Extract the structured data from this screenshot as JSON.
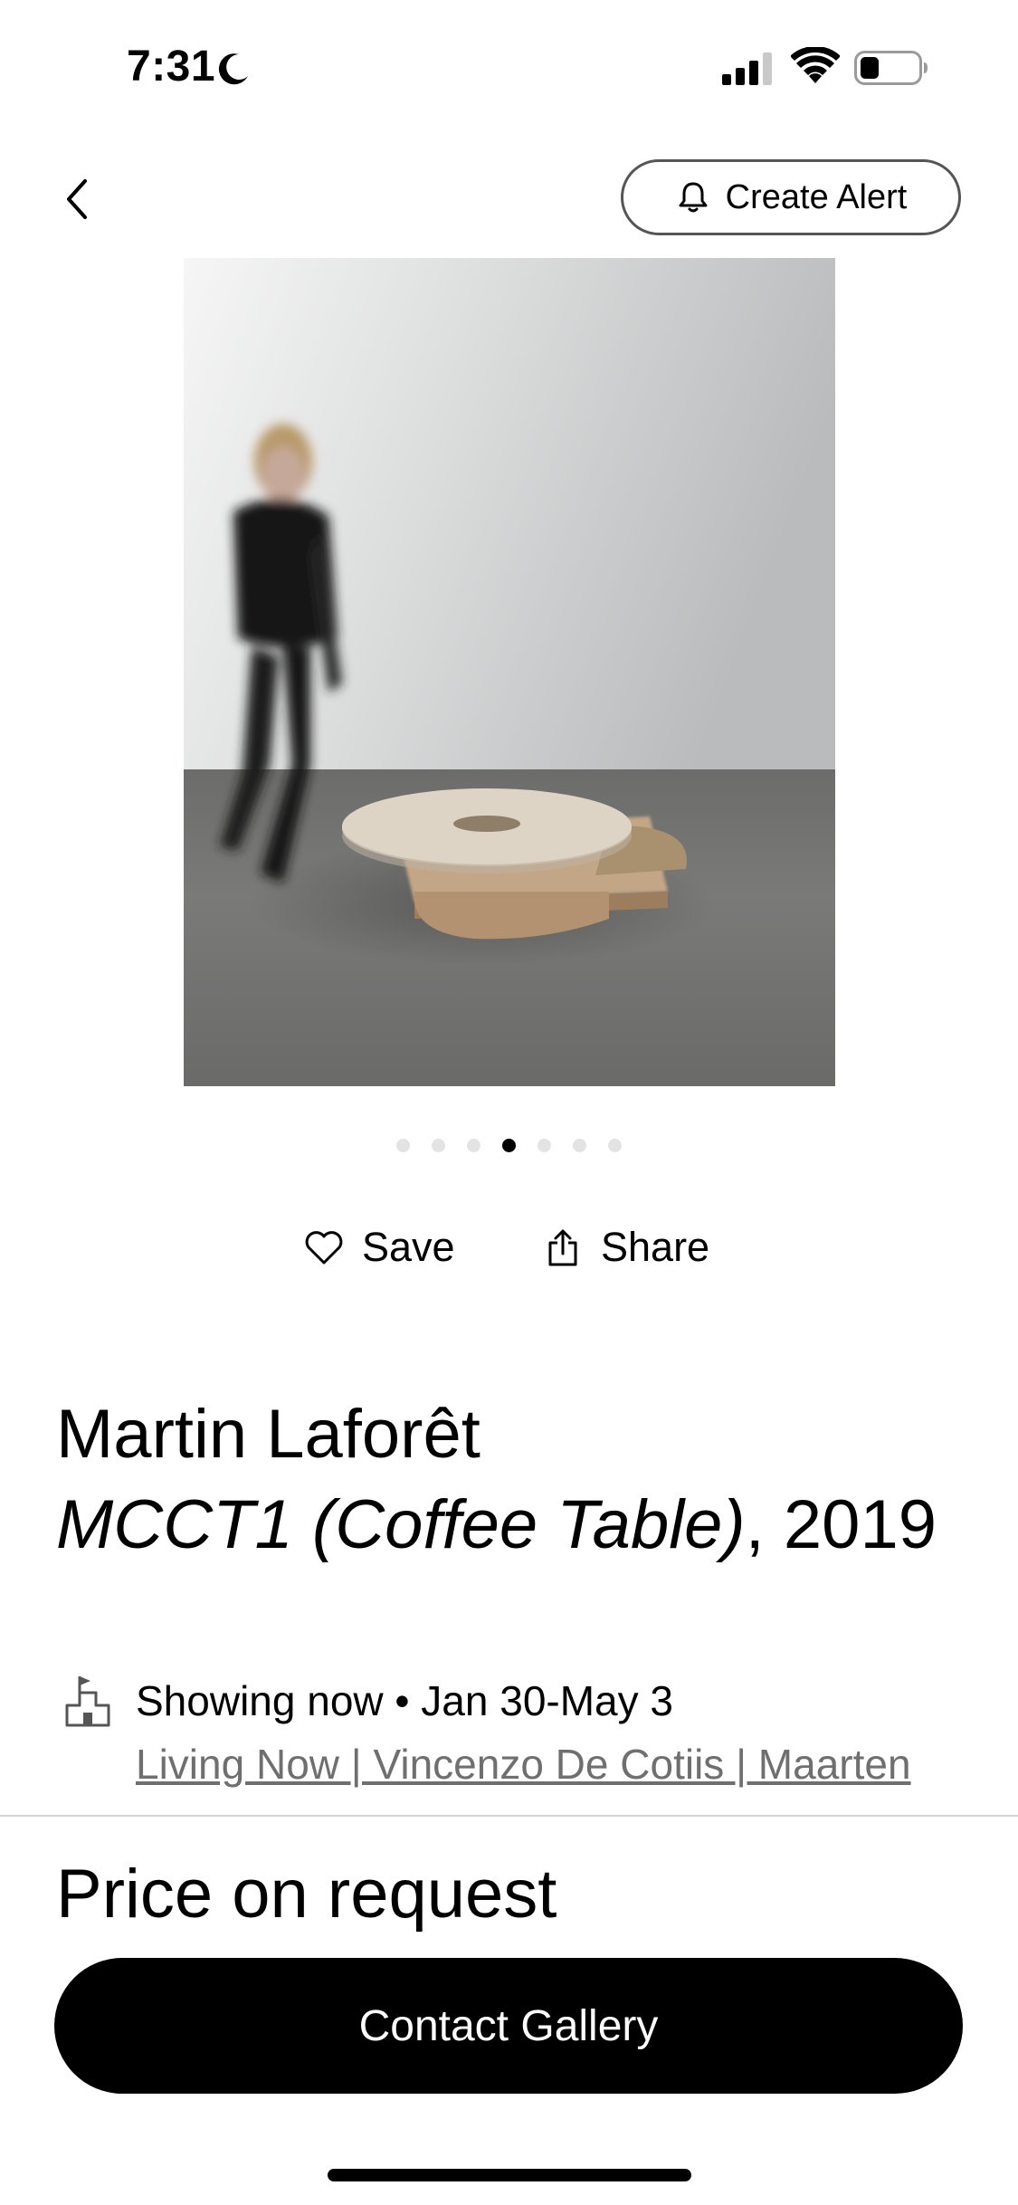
{
  "status_bar": {
    "time": "7:31",
    "icons": [
      "moon-icon",
      "cellular-signal-icon",
      "wifi-icon",
      "battery-icon"
    ]
  },
  "header": {
    "back_icon": "chevron-left-icon",
    "create_alert_label": "Create Alert",
    "create_alert_icon": "bell-icon"
  },
  "carousel": {
    "total": 7,
    "active_index": 3
  },
  "actions": {
    "save_label": "Save",
    "save_icon": "heart-icon",
    "share_label": "Share",
    "share_icon": "share-icon"
  },
  "artwork": {
    "artist": "Martin Laforêt",
    "title": "MCCT1 (Coffee Table)",
    "year": ", 2019"
  },
  "show": {
    "status": "Showing now • Jan 30-May 3",
    "link": "Living Now | Vincenzo De Cotiis | Maarten",
    "icon": "gallery-building-icon"
  },
  "commercial": {
    "price": "Price on request",
    "contact_label": "Contact Gallery"
  }
}
